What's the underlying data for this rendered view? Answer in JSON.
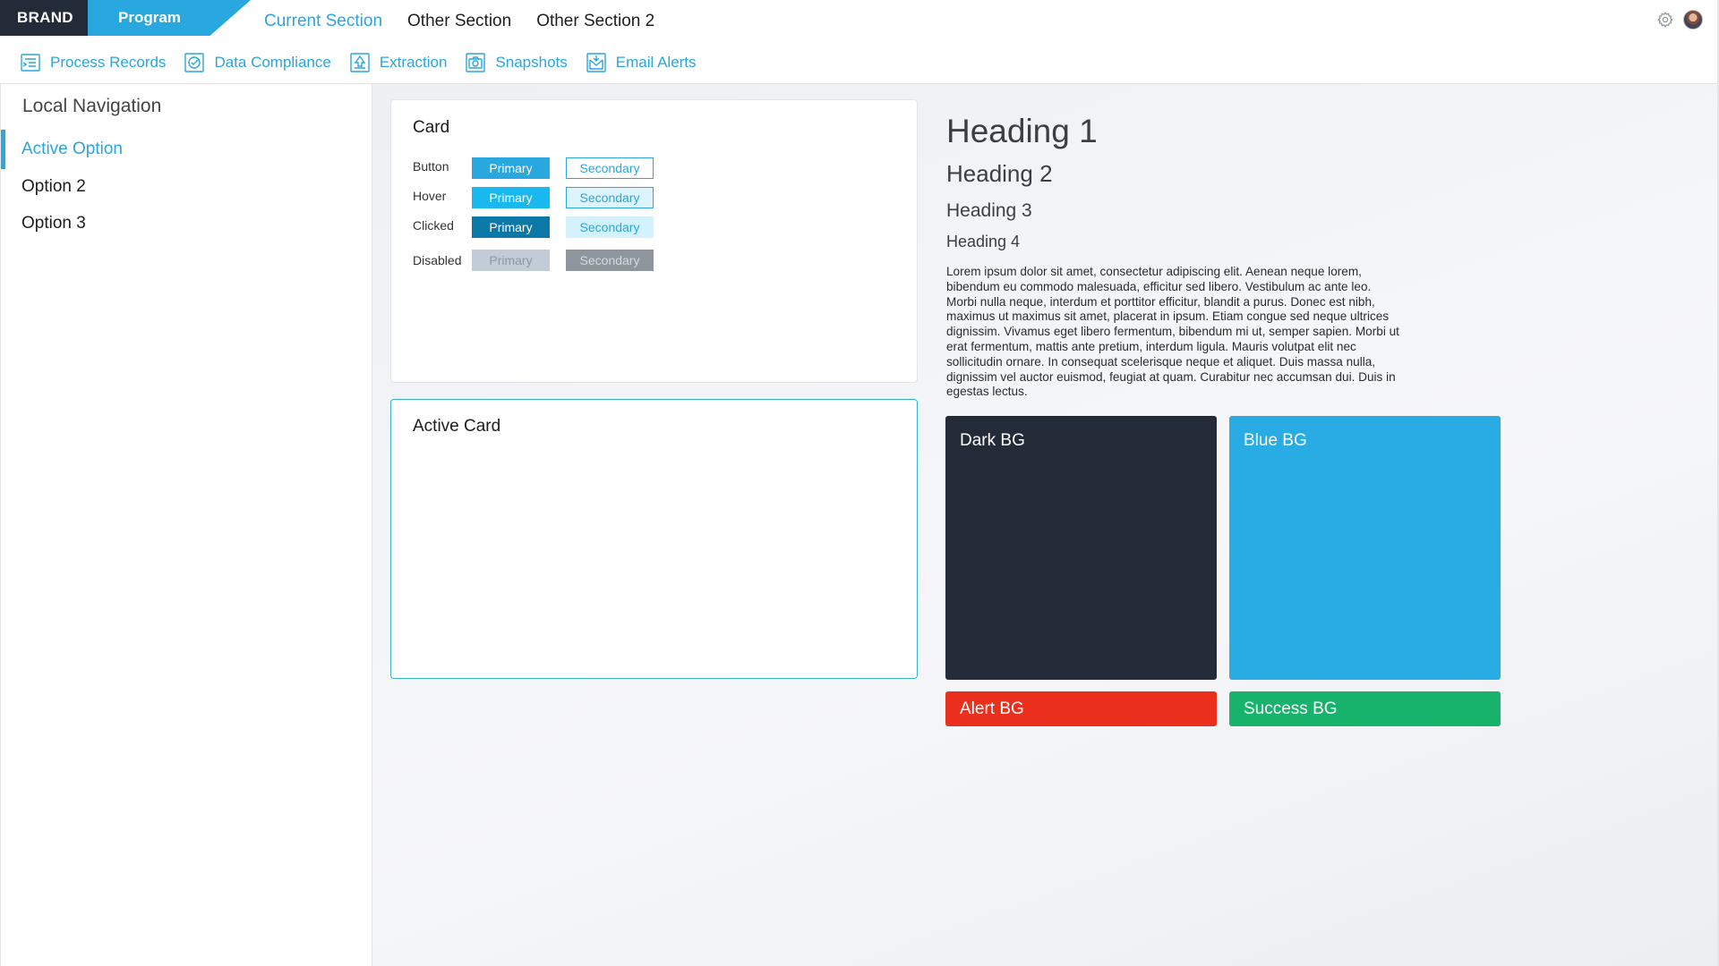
{
  "header": {
    "brand": "BRAND",
    "program": "Program",
    "sections": [
      {
        "label": "Current Section",
        "current": true
      },
      {
        "label": "Other Section",
        "current": false
      },
      {
        "label": "Other Section 2",
        "current": false
      }
    ]
  },
  "subnav": {
    "items": [
      {
        "label": "Process Records",
        "icon": "process-records-icon"
      },
      {
        "label": "Data Compliance",
        "icon": "data-compliance-icon"
      },
      {
        "label": "Extraction",
        "icon": "extraction-icon"
      },
      {
        "label": "Snapshots",
        "icon": "snapshots-icon"
      },
      {
        "label": "Email Alerts",
        "icon": "email-alerts-icon"
      }
    ]
  },
  "sidebar": {
    "title": "Local Navigation",
    "items": [
      {
        "label": "Active Option",
        "active": true
      },
      {
        "label": "Option 2",
        "active": false
      },
      {
        "label": "Option 3",
        "active": false
      }
    ]
  },
  "card": {
    "title": "Card",
    "rows": [
      {
        "label": "Button",
        "primary": "Primary",
        "secondary": "Secondary"
      },
      {
        "label": "Hover",
        "primary": "Primary",
        "secondary": "Secondary"
      },
      {
        "label": "Clicked",
        "primary": "Primary",
        "secondary": "Secondary"
      },
      {
        "label": "Disabled",
        "primary": "Primary",
        "secondary": "Secondary"
      }
    ]
  },
  "active_card": {
    "title": "Active Card"
  },
  "typography": {
    "h1": "Heading 1",
    "h2": "Heading 2",
    "h3": "Heading 3",
    "h4": "Heading 4",
    "body": "Lorem ipsum dolor sit amet, consectetur adipiscing elit. Aenean neque lorem, bibendum eu commodo malesuada, efficitur sed libero. Vestibulum ac ante leo. Morbi nulla neque, interdum et porttitor efficitur, blandit a purus. Donec est nibh, maximus ut maximus sit amet, placerat in ipsum. Etiam congue sed neque ultrices dignissim. Vivamus eget libero fermentum, bibendum mi ut, semper sapien. Morbi ut erat fermentum, mattis ante pretium, interdum ligula. Mauris volutpat elit nec sollicitudin ornare. In consequat scelerisque neque et aliquet. Duis massa nulla, dignissim vel auctor euismod, feugiat at quam. Curabitur nec accumsan dui. Duis in egestas lectus."
  },
  "swatches": {
    "dark": "Dark BG",
    "blue": "Blue BG",
    "alert": "Alert BG",
    "success": "Success BG"
  },
  "colors": {
    "brand_dark": "#232b38",
    "accent_blue": "#29a8e0",
    "alert_red": "#ea2f1c",
    "success_green": "#17b26b"
  }
}
